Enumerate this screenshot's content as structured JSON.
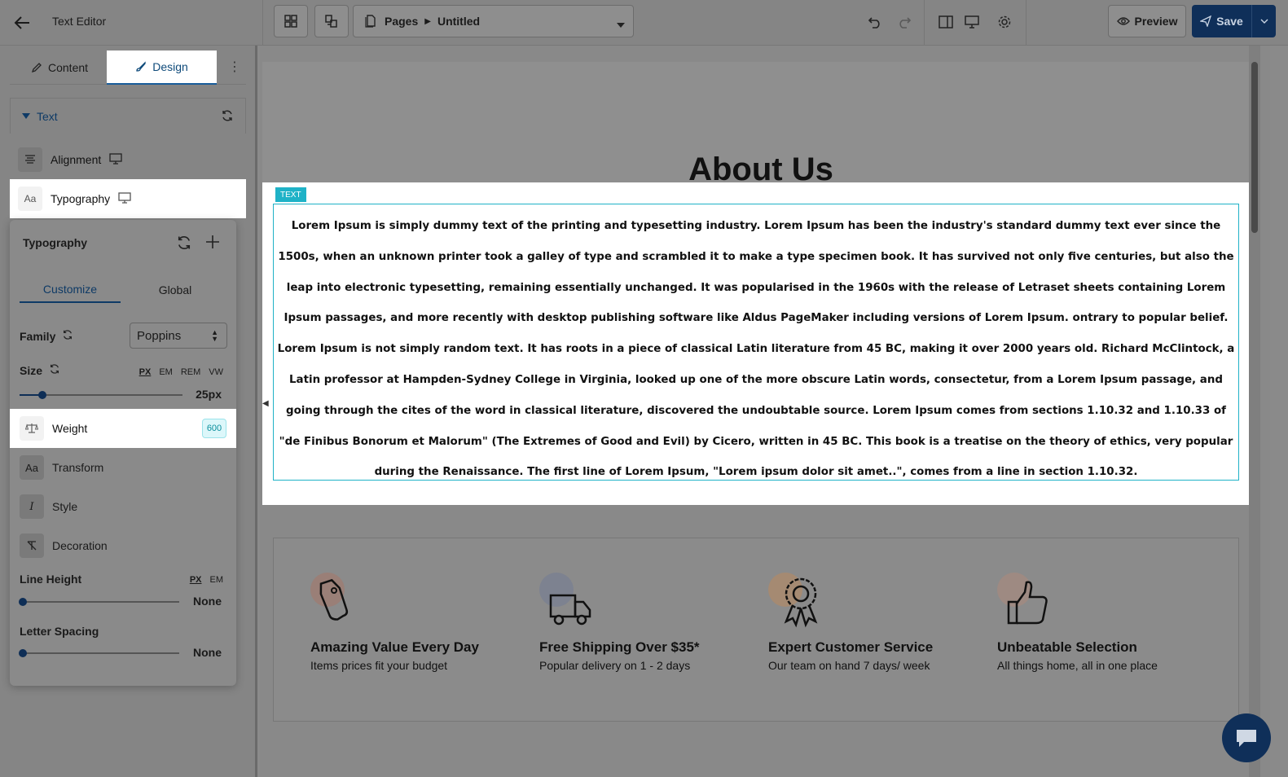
{
  "topbar": {
    "title": "Text Editor",
    "pages_label": "Pages",
    "page_name": "Untitled",
    "preview_label": "Preview",
    "save_label": "Save"
  },
  "left_panel": {
    "tabs": {
      "content": "Content",
      "design": "Design"
    },
    "section_title": "Text",
    "rows": {
      "alignment": "Alignment",
      "typography": "Typography"
    },
    "typography_popover": {
      "title": "Typography",
      "subtabs": {
        "customize": "Customize",
        "global": "Global"
      },
      "family_label": "Family",
      "family_value": "Poppins",
      "size_label": "Size",
      "size_units": [
        "PX",
        "EM",
        "REM",
        "VW"
      ],
      "size_value": "25px",
      "size_fraction": 0.14,
      "weight_label": "Weight",
      "weight_value": "600",
      "transform_label": "Transform",
      "style_label": "Style",
      "decoration_label": "Decoration",
      "line_height_label": "Line Height",
      "line_height_units": [
        "PX",
        "EM"
      ],
      "line_height_value": "None",
      "letter_spacing_label": "Letter Spacing",
      "letter_spacing_value": "None"
    }
  },
  "canvas": {
    "heading": "About Us",
    "text_tag": "TEXT",
    "paragraph_1": "Lorem Ipsum is simply dummy text of the printing and typesetting industry. Lorem Ipsum has been the industry's standard dummy text ever since the 1500s, when an unknown printer took a galley of type and scrambled it to make a type specimen book. It has survived not only five centuries, but also the leap into electronic typesetting, remaining essentially unchanged. It was popularised in the 1960s with the release of Letraset sheets containing Lorem Ipsum passages, and more recently with desktop publishing software like Aldus PageMaker including versions of Lorem Ipsum. ontrary to popular belief.",
    "paragraph_2": "Lorem Ipsum is not simply random text. It has roots in a piece of classical Latin literature from 45 BC, making it over 2000 years old. Richard McClintock, a Latin professor at Hampden-Sydney College in Virginia, looked up one of the more obscure Latin words, consectetur, from a Lorem Ipsum passage, and going through the cites of the word in classical literature, discovered the undoubtable source. Lorem Ipsum comes from sections 1.10.32 and 1.10.33 of \"de Finibus Bonorum et Malorum\" (The Extremes of Good and Evil) by Cicero, written in 45 BC. This book is a treatise on the theory of ethics, very popular during the Renaissance. The first line of Lorem Ipsum, \"Lorem ipsum dolor sit amet..\", comes from a line in section 1.10.32.",
    "features": [
      {
        "icon": "price-tag-icon",
        "title": "Amazing Value Every Day",
        "desc": "Items prices fit your budget",
        "accent": "#9a7f77"
      },
      {
        "icon": "truck-icon",
        "title": "Free Shipping Over $35*",
        "desc": "Popular delivery on 1 - 2 days",
        "accent": "#7d8290"
      },
      {
        "icon": "award-ribbon-icon",
        "title": "Expert Customer Service",
        "desc": "Our team on hand 7 days/ week",
        "accent": "#a58a72"
      },
      {
        "icon": "thumbs-up-icon",
        "title": "Unbeatable Selection",
        "desc": "All things home, all in one place",
        "accent": "#9e8a82"
      }
    ]
  },
  "colors": {
    "accent_teal": "#1fb2c7",
    "save_navy": "#0f2f59",
    "tab_active": "#0e4a7a"
  }
}
